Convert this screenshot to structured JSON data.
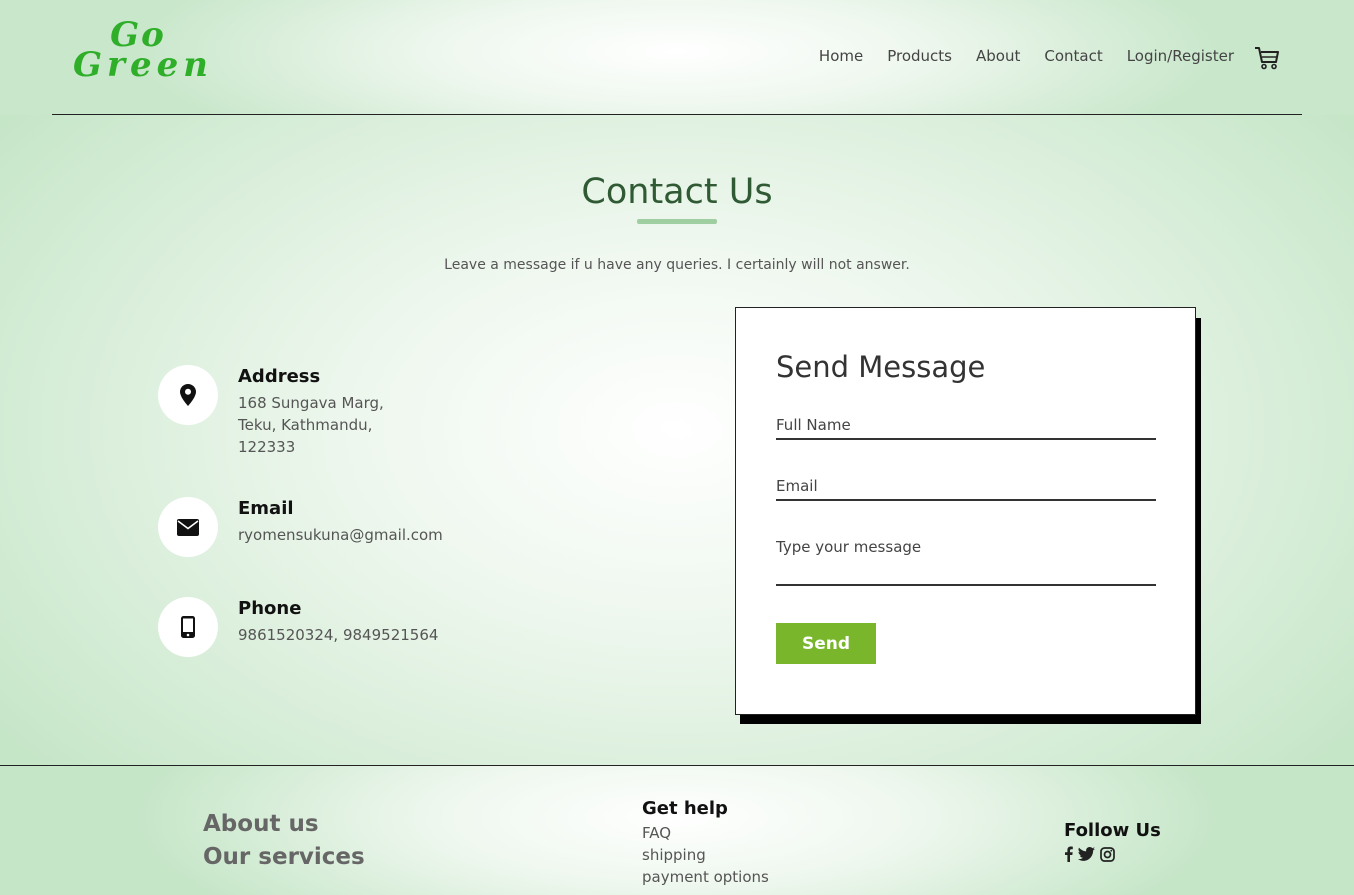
{
  "brand": {
    "line1": "Go",
    "line2": "Green"
  },
  "nav": {
    "items": [
      "Home",
      "Products",
      "About",
      "Contact",
      "Login/Register"
    ],
    "cart_icon": "cart-icon"
  },
  "contact": {
    "title": "Contact Us",
    "subtitle": "Leave a message if u have any queries. I certainly will not answer."
  },
  "info": {
    "address": {
      "label": "Address",
      "lines": [
        "168 Sungava Marg,",
        "Teku, Kathmandu,",
        "122333"
      ],
      "icon": "map-marker-icon"
    },
    "email": {
      "label": "Email",
      "value": "ryomensukuna@gmail.com",
      "icon": "envelope-icon"
    },
    "phone": {
      "label": "Phone",
      "value": "9861520324, 9849521564",
      "icon": "mobile-phone-icon"
    }
  },
  "form": {
    "title": "Send Message",
    "name_placeholder": "Full Name",
    "email_placeholder": "Email",
    "message_placeholder": "Type your message",
    "send_label": "Send"
  },
  "footer": {
    "about": "About us",
    "services": "Our services",
    "help_title": "Get help",
    "help_links": [
      "FAQ",
      "shipping",
      "payment options"
    ],
    "follow_title": "Follow Us",
    "social_icons": [
      "facebook-icon",
      "twitter-icon",
      "instagram-icon"
    ]
  },
  "colors": {
    "brand_green": "#2fae2a",
    "button_green": "#7ab62c",
    "title_green": "#2f5a33"
  }
}
